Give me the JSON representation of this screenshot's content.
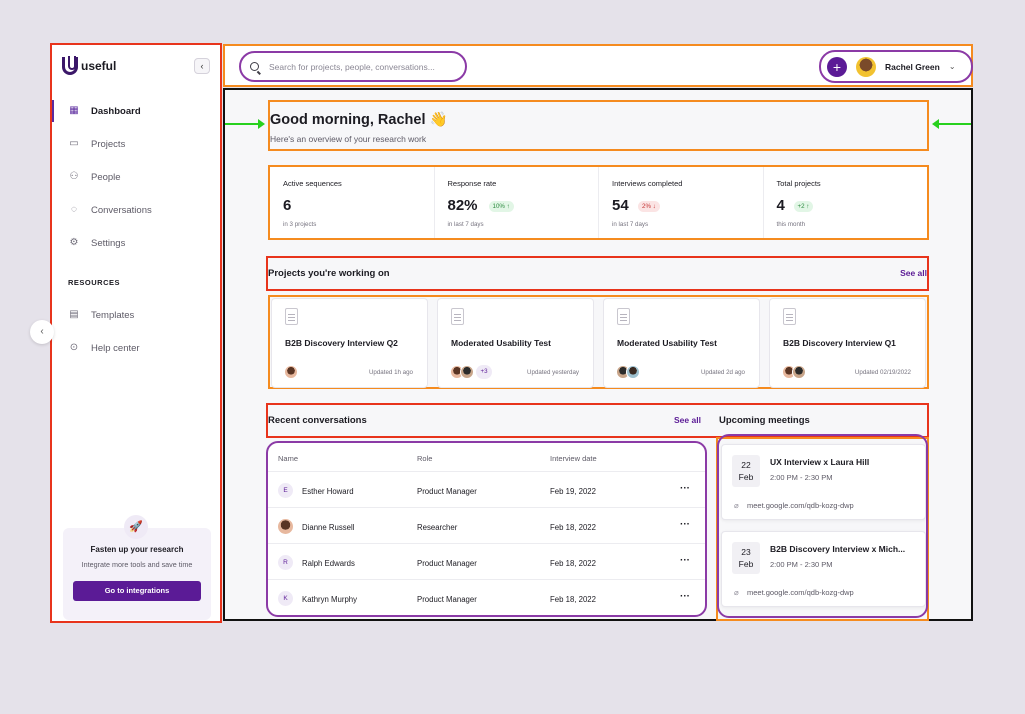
{
  "app": {
    "name": "useful"
  },
  "sidebar": {
    "items": [
      {
        "label": "Dashboard",
        "icon": "dashboard-icon"
      },
      {
        "label": "Projects",
        "icon": "folder-icon"
      },
      {
        "label": "People",
        "icon": "people-icon"
      },
      {
        "label": "Conversations",
        "icon": "chat-icon"
      },
      {
        "label": "Settings",
        "icon": "gear-icon"
      }
    ],
    "resources_title": "RESOURCES",
    "resources": [
      {
        "label": "Templates",
        "icon": "template-icon"
      },
      {
        "label": "Help center",
        "icon": "help-icon"
      }
    ],
    "promo": {
      "title": "Fasten up your research",
      "text": "Integrate more tools and save time",
      "button": "Go to integrations"
    }
  },
  "topbar": {
    "search_placeholder": "Search for projects, people, conversations...",
    "user_name": "Rachel Green"
  },
  "greeting": {
    "title": "Good morning, Rachel 👋",
    "subtitle": "Here's an overview of your research work"
  },
  "stats": [
    {
      "label": "Active sequences",
      "value": "6",
      "badge": "",
      "note": "in 3 projects"
    },
    {
      "label": "Response rate",
      "value": "82%",
      "badge": "10% ↑",
      "trend": "up",
      "note": "in last 7 days"
    },
    {
      "label": "Interviews completed",
      "value": "54",
      "badge": "2% ↓",
      "trend": "down",
      "note": "in last 7 days"
    },
    {
      "label": "Total projects",
      "value": "4",
      "badge": "+2 ↑",
      "trend": "up",
      "note": "this month"
    }
  ],
  "projects_section": {
    "title": "Projects you're working on",
    "link": "See all"
  },
  "projects": [
    {
      "title": "B2B Discovery Interview Q2",
      "updated": "Updated 1h ago",
      "more": ""
    },
    {
      "title": "Moderated Usability Test",
      "updated": "Updated yesterday",
      "more": "+3"
    },
    {
      "title": "Moderated Usability Test",
      "updated": "Updated 2d ago",
      "more": ""
    },
    {
      "title": "B2B Discovery Interview Q1",
      "updated": "Updated 02/19/2022",
      "more": ""
    }
  ],
  "conversations_section": {
    "title": "Recent conversations",
    "link": "See all"
  },
  "conversations": {
    "columns": [
      "Name",
      "Role",
      "Interview date"
    ],
    "rows": [
      {
        "initial": "E",
        "name": "Esther Howard",
        "role": "Product Manager",
        "date": "Feb 19, 2022"
      },
      {
        "initial": "",
        "name": "Dianne Russell",
        "role": "Researcher",
        "date": "Feb 18, 2022"
      },
      {
        "initial": "R",
        "name": "Ralph Edwards",
        "role": "Product Manager",
        "date": "Feb 18, 2022"
      },
      {
        "initial": "K",
        "name": "Kathryn Murphy",
        "role": "Product Manager",
        "date": "Feb 18, 2022"
      }
    ],
    "more": "···"
  },
  "meetings_section": {
    "title": "Upcoming meetings"
  },
  "meetings": [
    {
      "day": "22",
      "month": "Feb",
      "title": "UX Interview x Laura Hill",
      "time": "2:00 PM - 2:30 PM",
      "link": "meet.google.com/qdb-kozg-dwp"
    },
    {
      "day": "23",
      "month": "Feb",
      "title": "B2B Discovery Interview x Mich...",
      "time": "2:00 PM - 2:30 PM",
      "link": "meet.google.com/qdb-kozg-dwp"
    }
  ],
  "colors": {
    "brand": "#5b1b96",
    "up": "#2c8a3f",
    "down": "#c43434"
  }
}
